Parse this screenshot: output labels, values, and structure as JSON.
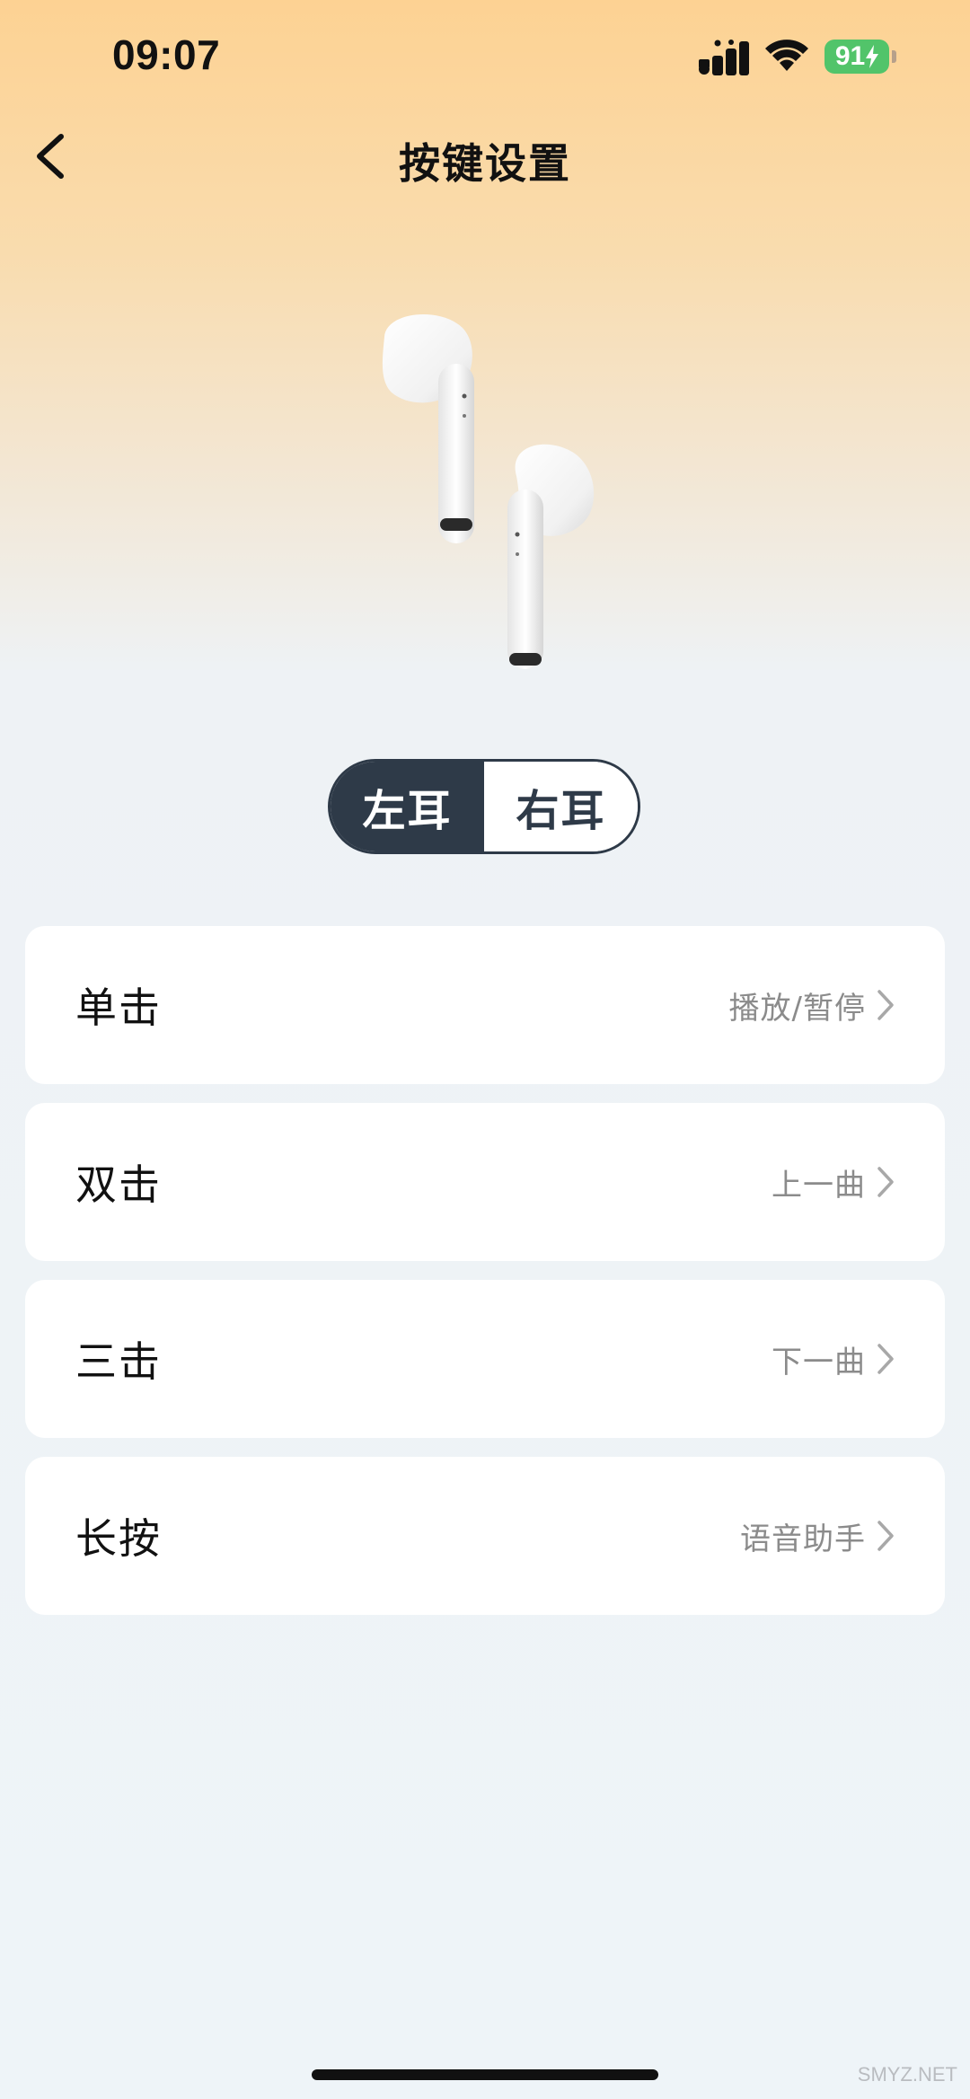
{
  "status_bar": {
    "time": "09:07",
    "battery_level": "91",
    "battery_color": "#52c46a",
    "icons": [
      "signal-icon",
      "wifi-icon",
      "battery-icon",
      "charging-bolt-icon"
    ]
  },
  "header": {
    "title": "按键设置",
    "back_icon": "chevron-left-icon"
  },
  "ear_toggle": {
    "options": [
      {
        "label": "左耳",
        "selected": true
      },
      {
        "label": "右耳",
        "selected": false
      }
    ],
    "active_color": "#2e3a48"
  },
  "gestures": [
    {
      "label": "单击",
      "value": "播放/暂停"
    },
    {
      "label": "双击",
      "value": "上一曲"
    },
    {
      "label": "三击",
      "value": "下一曲"
    },
    {
      "label": "长按",
      "value": "语音助手"
    }
  ],
  "watermark": "SMYZ.NET"
}
